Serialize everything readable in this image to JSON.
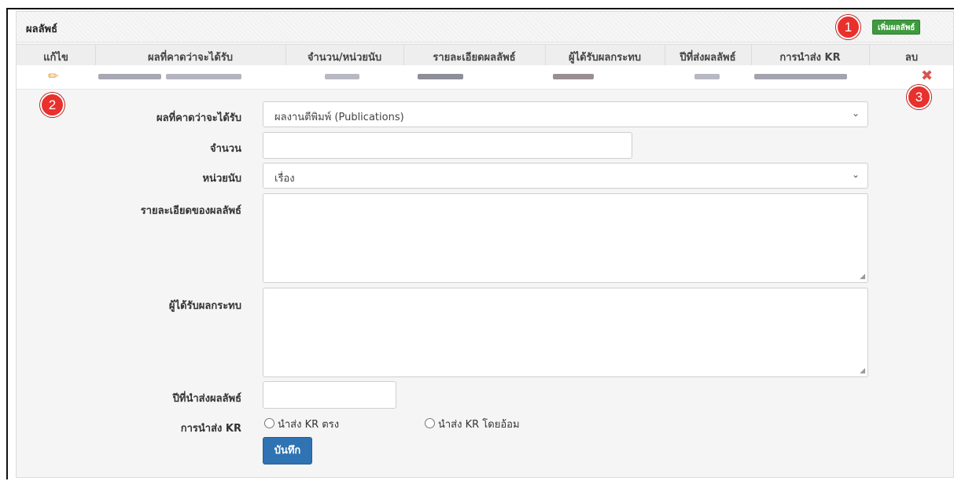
{
  "panel": {
    "title": "ผลลัพธ์",
    "add_button": "เพิ่มผลลัพธ์"
  },
  "callouts": [
    "1",
    "2",
    "3"
  ],
  "table": {
    "headers": [
      "แก้ไข",
      "ผลที่คาดว่าจะได้รับ",
      "จำนวน/หน่วยนับ",
      "รายละเอียดผลลัพธ์",
      "ผู้ได้รับผลกระทบ",
      "ปีที่ส่งผลลัพธ์",
      "การนำส่ง KR",
      "ลบ"
    ],
    "edit_icon": "pencil-icon",
    "delete_icon": "close-icon"
  },
  "form": {
    "expected_label": "ผลที่คาดว่าจะได้รับ",
    "expected_value": "ผลงานตีพิมพ์ (Publications)",
    "amount_label": "จำนวน",
    "amount_value": "",
    "unit_label": "หน่วยนับ",
    "unit_value": "เรื่อง",
    "detail_label": "รายละเอียดของผลลัพธ์",
    "detail_value": "",
    "affected_label": "ผู้ได้รับผลกระทบ",
    "affected_value": "",
    "year_label": "ปีที่นำส่งผลลัพธ์",
    "year_value": "",
    "kr_label": "การนำส่ง KR",
    "kr_option_direct": "นำส่ง KR ตรง",
    "kr_option_indirect": "นำส่ง KR โดยอ้อม",
    "save_button": "บันทึก"
  },
  "colors": {
    "add_button": "#3d9b3d",
    "save_button": "#2f73b3",
    "callout": "#e8302c",
    "delete_icon": "#d9534f",
    "edit_icon": "#e3a33a"
  }
}
